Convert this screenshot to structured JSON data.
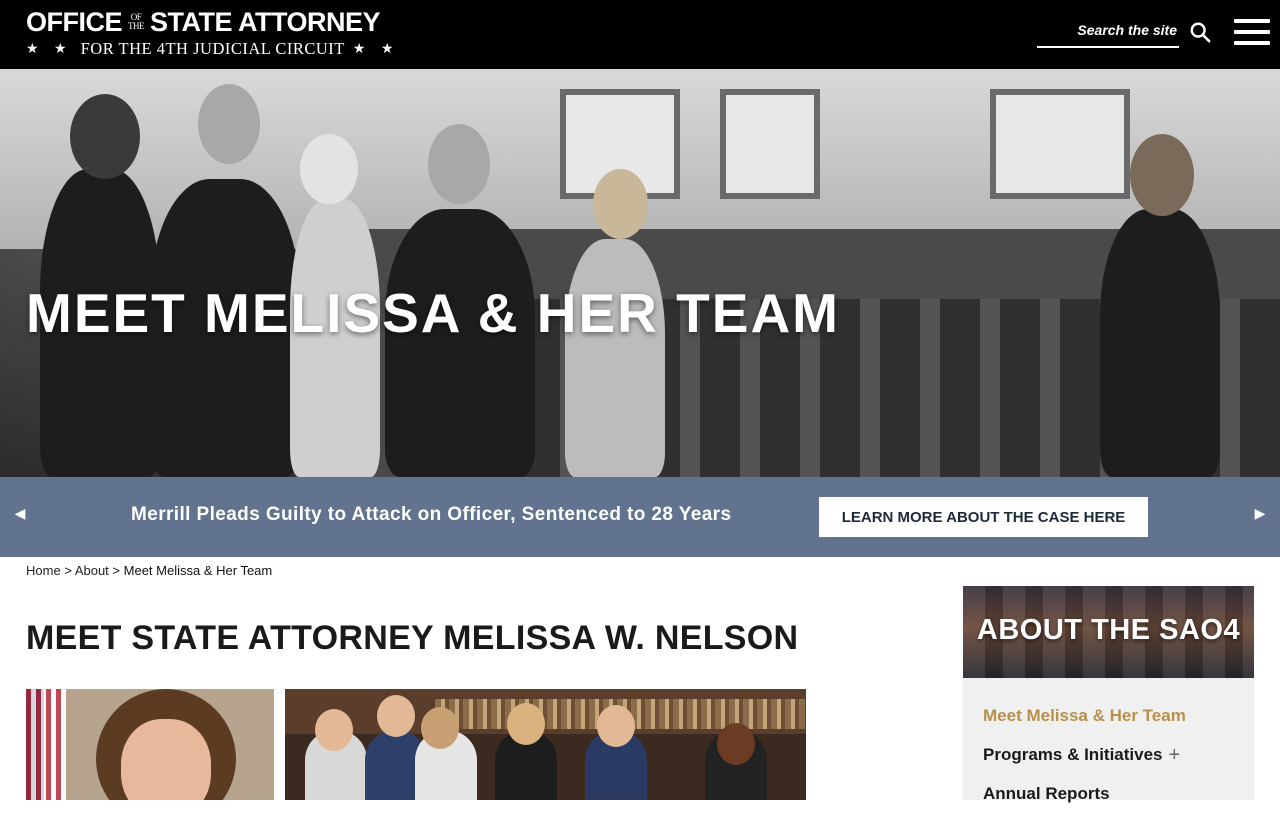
{
  "header": {
    "logo": {
      "word1": "OFFICE",
      "of": "OF",
      "the": "THE",
      "word2": "STATE ATTORNEY",
      "stars": "★ ★",
      "subtitle": "FOR THE 4TH JUDICIAL CIRCUIT"
    },
    "search_placeholder": "Search the site",
    "search_icon": "search-icon",
    "menu_icon": "hamburger-menu-icon"
  },
  "hero": {
    "title": "MEET MELISSA & HER TEAM"
  },
  "ticker": {
    "prev_icon": "◀",
    "next_icon": "▶",
    "headline": "Merrill Pleads Guilty to Attack on Officer, Sentenced to 28 Years",
    "button_label": "LEARN MORE ABOUT THE CASE HERE",
    "background": "#61738f"
  },
  "breadcrumb": {
    "home": "Home",
    "sep1": ">",
    "about": "About",
    "sep2": ">",
    "current": "Meet Melissa & Her Team"
  },
  "main": {
    "title": "MEET STATE ATTORNEY MELISSA W. NELSON"
  },
  "sidebar": {
    "title": "ABOUT THE SAO4",
    "items": [
      {
        "label": "Meet Melissa & Her Team",
        "active": true
      },
      {
        "label": "Programs & Initiatives",
        "expand": "+"
      },
      {
        "label": "Annual Reports"
      }
    ],
    "active_color": "#b7914a"
  }
}
